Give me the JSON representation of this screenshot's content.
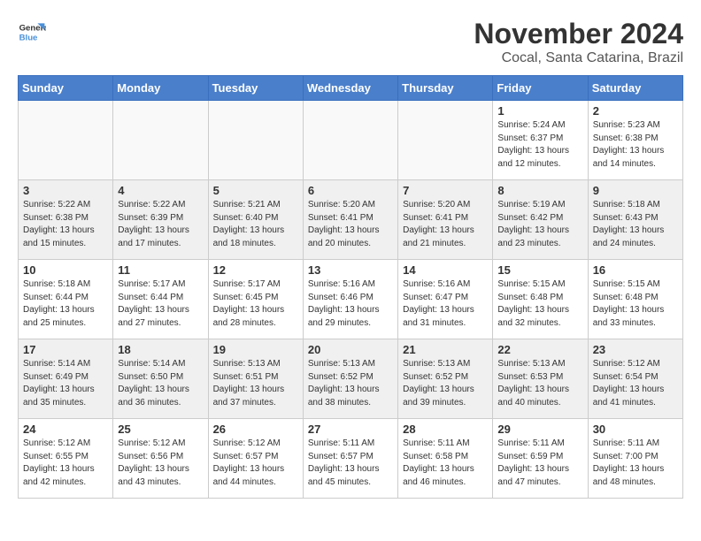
{
  "logo": {
    "line1": "General",
    "line2": "Blue"
  },
  "title": "November 2024",
  "subtitle": "Cocal, Santa Catarina, Brazil",
  "days_of_week": [
    "Sunday",
    "Monday",
    "Tuesday",
    "Wednesday",
    "Thursday",
    "Friday",
    "Saturday"
  ],
  "weeks": [
    [
      {
        "day": "",
        "info": ""
      },
      {
        "day": "",
        "info": ""
      },
      {
        "day": "",
        "info": ""
      },
      {
        "day": "",
        "info": ""
      },
      {
        "day": "",
        "info": ""
      },
      {
        "day": "1",
        "info": "Sunrise: 5:24 AM\nSunset: 6:37 PM\nDaylight: 13 hours\nand 12 minutes."
      },
      {
        "day": "2",
        "info": "Sunrise: 5:23 AM\nSunset: 6:38 PM\nDaylight: 13 hours\nand 14 minutes."
      }
    ],
    [
      {
        "day": "3",
        "info": "Sunrise: 5:22 AM\nSunset: 6:38 PM\nDaylight: 13 hours\nand 15 minutes."
      },
      {
        "day": "4",
        "info": "Sunrise: 5:22 AM\nSunset: 6:39 PM\nDaylight: 13 hours\nand 17 minutes."
      },
      {
        "day": "5",
        "info": "Sunrise: 5:21 AM\nSunset: 6:40 PM\nDaylight: 13 hours\nand 18 minutes."
      },
      {
        "day": "6",
        "info": "Sunrise: 5:20 AM\nSunset: 6:41 PM\nDaylight: 13 hours\nand 20 minutes."
      },
      {
        "day": "7",
        "info": "Sunrise: 5:20 AM\nSunset: 6:41 PM\nDaylight: 13 hours\nand 21 minutes."
      },
      {
        "day": "8",
        "info": "Sunrise: 5:19 AM\nSunset: 6:42 PM\nDaylight: 13 hours\nand 23 minutes."
      },
      {
        "day": "9",
        "info": "Sunrise: 5:18 AM\nSunset: 6:43 PM\nDaylight: 13 hours\nand 24 minutes."
      }
    ],
    [
      {
        "day": "10",
        "info": "Sunrise: 5:18 AM\nSunset: 6:44 PM\nDaylight: 13 hours\nand 25 minutes."
      },
      {
        "day": "11",
        "info": "Sunrise: 5:17 AM\nSunset: 6:44 PM\nDaylight: 13 hours\nand 27 minutes."
      },
      {
        "day": "12",
        "info": "Sunrise: 5:17 AM\nSunset: 6:45 PM\nDaylight: 13 hours\nand 28 minutes."
      },
      {
        "day": "13",
        "info": "Sunrise: 5:16 AM\nSunset: 6:46 PM\nDaylight: 13 hours\nand 29 minutes."
      },
      {
        "day": "14",
        "info": "Sunrise: 5:16 AM\nSunset: 6:47 PM\nDaylight: 13 hours\nand 31 minutes."
      },
      {
        "day": "15",
        "info": "Sunrise: 5:15 AM\nSunset: 6:48 PM\nDaylight: 13 hours\nand 32 minutes."
      },
      {
        "day": "16",
        "info": "Sunrise: 5:15 AM\nSunset: 6:48 PM\nDaylight: 13 hours\nand 33 minutes."
      }
    ],
    [
      {
        "day": "17",
        "info": "Sunrise: 5:14 AM\nSunset: 6:49 PM\nDaylight: 13 hours\nand 35 minutes."
      },
      {
        "day": "18",
        "info": "Sunrise: 5:14 AM\nSunset: 6:50 PM\nDaylight: 13 hours\nand 36 minutes."
      },
      {
        "day": "19",
        "info": "Sunrise: 5:13 AM\nSunset: 6:51 PM\nDaylight: 13 hours\nand 37 minutes."
      },
      {
        "day": "20",
        "info": "Sunrise: 5:13 AM\nSunset: 6:52 PM\nDaylight: 13 hours\nand 38 minutes."
      },
      {
        "day": "21",
        "info": "Sunrise: 5:13 AM\nSunset: 6:52 PM\nDaylight: 13 hours\nand 39 minutes."
      },
      {
        "day": "22",
        "info": "Sunrise: 5:13 AM\nSunset: 6:53 PM\nDaylight: 13 hours\nand 40 minutes."
      },
      {
        "day": "23",
        "info": "Sunrise: 5:12 AM\nSunset: 6:54 PM\nDaylight: 13 hours\nand 41 minutes."
      }
    ],
    [
      {
        "day": "24",
        "info": "Sunrise: 5:12 AM\nSunset: 6:55 PM\nDaylight: 13 hours\nand 42 minutes."
      },
      {
        "day": "25",
        "info": "Sunrise: 5:12 AM\nSunset: 6:56 PM\nDaylight: 13 hours\nand 43 minutes."
      },
      {
        "day": "26",
        "info": "Sunrise: 5:12 AM\nSunset: 6:57 PM\nDaylight: 13 hours\nand 44 minutes."
      },
      {
        "day": "27",
        "info": "Sunrise: 5:11 AM\nSunset: 6:57 PM\nDaylight: 13 hours\nand 45 minutes."
      },
      {
        "day": "28",
        "info": "Sunrise: 5:11 AM\nSunset: 6:58 PM\nDaylight: 13 hours\nand 46 minutes."
      },
      {
        "day": "29",
        "info": "Sunrise: 5:11 AM\nSunset: 6:59 PM\nDaylight: 13 hours\nand 47 minutes."
      },
      {
        "day": "30",
        "info": "Sunrise: 5:11 AM\nSunset: 7:00 PM\nDaylight: 13 hours\nand 48 minutes."
      }
    ]
  ]
}
